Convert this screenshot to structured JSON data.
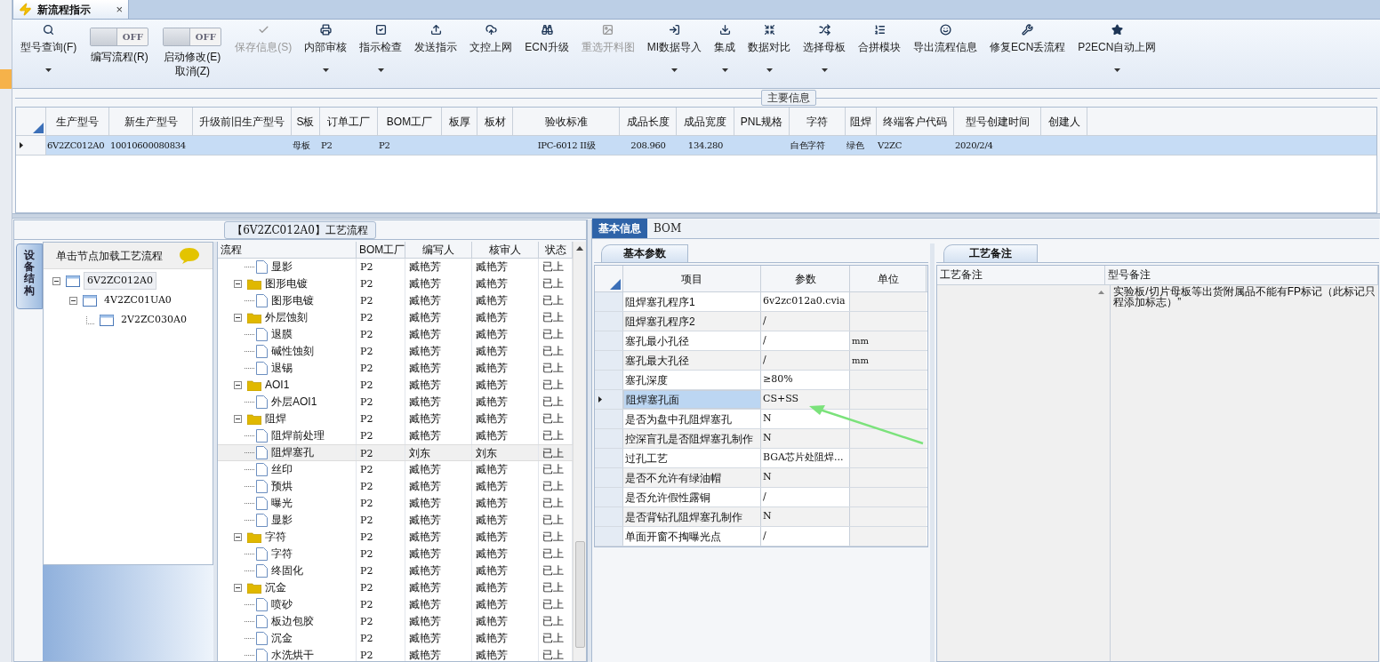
{
  "document_tab": {
    "title": "新流程指示",
    "close": "×"
  },
  "toolbar": [
    {
      "kind": "button",
      "label": "型号查询(F)",
      "dropdown": true,
      "disabled": false
    },
    {
      "kind": "toggle",
      "label": "编写流程(R)",
      "switch": "OFF",
      "on": false
    },
    {
      "kind": "toggle",
      "label": "启动修改(E)",
      "sublabel": "取消(Z)",
      "switch": "OFF",
      "on": false
    },
    {
      "kind": "button",
      "label": "保存信息(S)",
      "dropdown": false,
      "disabled": true
    },
    {
      "kind": "button",
      "label": "内部审核",
      "dropdown": true,
      "disabled": false
    },
    {
      "kind": "button",
      "label": "指示检查",
      "dropdown": true,
      "disabled": false
    },
    {
      "kind": "button",
      "label": "发送指示",
      "dropdown": false,
      "disabled": false
    },
    {
      "kind": "button",
      "label": "文控上网",
      "dropdown": false,
      "disabled": false
    },
    {
      "kind": "button",
      "label": "ECN升级",
      "dropdown": false,
      "disabled": false
    },
    {
      "kind": "button",
      "label": "重选开料图",
      "dropdown": false,
      "disabled": true
    },
    {
      "kind": "button",
      "label": "MI数据导入",
      "dropdown": true,
      "disabled": false
    },
    {
      "kind": "button",
      "label": "集成",
      "dropdown": true,
      "disabled": false
    },
    {
      "kind": "button",
      "label": "数据对比",
      "dropdown": true,
      "disabled": false
    },
    {
      "kind": "button",
      "label": "选择母板",
      "dropdown": true,
      "disabled": false
    },
    {
      "kind": "button",
      "label": "合拼模块",
      "dropdown": false,
      "disabled": false
    },
    {
      "kind": "button",
      "label": "导出流程信息",
      "dropdown": false,
      "disabled": false
    },
    {
      "kind": "button",
      "label": "修复ECN丢流程",
      "dropdown": false,
      "disabled": false
    },
    {
      "kind": "button",
      "label": "P2ECN自动上网",
      "dropdown": true,
      "disabled": false
    }
  ],
  "main_info": {
    "title": "主要信息",
    "columns": [
      "生产型号",
      "新生产型号",
      "升级前旧生产型号",
      "S板",
      "订单工厂",
      "BOM工厂",
      "板厚",
      "板材",
      "验收标准",
      "成品长度",
      "成品宽度",
      "PNL规格",
      "字符",
      "阻焊",
      "终端客户代码",
      "型号创建时间",
      "创建人"
    ],
    "rows": [
      {
        "selected": true,
        "cells": [
          "6V2ZC012A0",
          "10010600080834",
          null,
          "母板",
          "P2",
          "P2",
          null,
          null,
          "IPC-6012 II级",
          "208.960",
          "134.280",
          null,
          "白色字符",
          "绿色",
          "V2ZC",
          "2020/2/4",
          null
        ]
      }
    ]
  },
  "process_panel": {
    "title": "【6V2ZC012A0】工艺流程",
    "side_tab": "设备结构",
    "tree_hint": "单击节点加载工艺流程",
    "tree": [
      {
        "label": "6V2ZC012A0",
        "selected": true,
        "expanded": true,
        "children": [
          {
            "label": "4V2ZC01UA0",
            "selected": false,
            "expanded": true,
            "children": [
              {
                "label": "2V2ZC030A0",
                "selected": false
              }
            ]
          }
        ]
      }
    ],
    "columns": [
      "流程",
      "BOM工厂",
      "编写人",
      "核审人",
      "状态"
    ],
    "rows": [
      {
        "kind": "step",
        "name": "显影",
        "factory": "P2",
        "writer": "臧艳芳",
        "reviewer": "臧艳芳",
        "status": "已上",
        "selected": false
      },
      {
        "kind": "folder",
        "name": "图形电镀",
        "factory": "P2",
        "writer": "臧艳芳",
        "reviewer": "臧艳芳",
        "status": "已上",
        "selected": false,
        "expanded": true,
        "children": [
          {
            "kind": "step",
            "name": "图形电镀",
            "factory": "P2",
            "writer": "臧艳芳",
            "reviewer": "臧艳芳",
            "status": "已上",
            "selected": false
          }
        ]
      },
      {
        "kind": "folder",
        "name": "外层蚀刻",
        "factory": "P2",
        "writer": "臧艳芳",
        "reviewer": "臧艳芳",
        "status": "已上",
        "selected": false,
        "expanded": true,
        "children": [
          {
            "kind": "step",
            "name": "退膜",
            "factory": "P2",
            "writer": "臧艳芳",
            "reviewer": "臧艳芳",
            "status": "已上",
            "selected": false
          },
          {
            "kind": "step",
            "name": "碱性蚀刻",
            "factory": "P2",
            "writer": "臧艳芳",
            "reviewer": "臧艳芳",
            "status": "已上",
            "selected": false
          },
          {
            "kind": "step",
            "name": "退锡",
            "factory": "P2",
            "writer": "臧艳芳",
            "reviewer": "臧艳芳",
            "status": "已上",
            "selected": false
          }
        ]
      },
      {
        "kind": "folder",
        "name": "AOI1",
        "factory": "P2",
        "writer": "臧艳芳",
        "reviewer": "臧艳芳",
        "status": "已上",
        "selected": false,
        "expanded": true,
        "children": [
          {
            "kind": "step",
            "name": "外层AOI1",
            "factory": "P2",
            "writer": "臧艳芳",
            "reviewer": "臧艳芳",
            "status": "已上",
            "selected": false
          }
        ]
      },
      {
        "kind": "folder",
        "name": "阻焊",
        "factory": "P2",
        "writer": "臧艳芳",
        "reviewer": "臧艳芳",
        "status": "已上",
        "selected": false,
        "expanded": true,
        "children": [
          {
            "kind": "step",
            "name": "阻焊前处理",
            "factory": "P2",
            "writer": "臧艳芳",
            "reviewer": "臧艳芳",
            "status": "已上",
            "selected": false
          },
          {
            "kind": "step",
            "name": "阻焊塞孔",
            "factory": "P2",
            "writer": "刘东",
            "reviewer": "刘东",
            "status": "已上",
            "selected": true
          },
          {
            "kind": "step",
            "name": "丝印",
            "factory": "P2",
            "writer": "臧艳芳",
            "reviewer": "臧艳芳",
            "status": "已上",
            "selected": false
          },
          {
            "kind": "step",
            "name": "预烘",
            "factory": "P2",
            "writer": "臧艳芳",
            "reviewer": "臧艳芳",
            "status": "已上",
            "selected": false
          },
          {
            "kind": "step",
            "name": "曝光",
            "factory": "P2",
            "writer": "臧艳芳",
            "reviewer": "臧艳芳",
            "status": "已上",
            "selected": false
          },
          {
            "kind": "step",
            "name": "显影",
            "factory": "P2",
            "writer": "臧艳芳",
            "reviewer": "臧艳芳",
            "status": "已上",
            "selected": false
          }
        ]
      },
      {
        "kind": "folder",
        "name": "字符",
        "factory": "P2",
        "writer": "臧艳芳",
        "reviewer": "臧艳芳",
        "status": "已上",
        "selected": false,
        "expanded": true,
        "children": [
          {
            "kind": "step",
            "name": "字符",
            "factory": "P2",
            "writer": "臧艳芳",
            "reviewer": "臧艳芳",
            "status": "已上",
            "selected": false
          },
          {
            "kind": "step",
            "name": "终固化",
            "factory": "P2",
            "writer": "臧艳芳",
            "reviewer": "臧艳芳",
            "status": "已上",
            "selected": false
          }
        ]
      },
      {
        "kind": "folder",
        "name": "沉金",
        "factory": "P2",
        "writer": "臧艳芳",
        "reviewer": "臧艳芳",
        "status": "已上",
        "selected": false,
        "expanded": true,
        "children": [
          {
            "kind": "step",
            "name": "喷砂",
            "factory": "P2",
            "writer": "臧艳芳",
            "reviewer": "臧艳芳",
            "status": "已上",
            "selected": false
          },
          {
            "kind": "step",
            "name": "板边包胶",
            "factory": "P2",
            "writer": "臧艳芳",
            "reviewer": "臧艳芳",
            "status": "已上",
            "selected": false
          },
          {
            "kind": "step",
            "name": "沉金",
            "factory": "P2",
            "writer": "臧艳芳",
            "reviewer": "臧艳芳",
            "status": "已上",
            "selected": false
          },
          {
            "kind": "step",
            "name": "水洗烘干",
            "factory": "P2",
            "writer": "臧艳芳",
            "reviewer": "臧艳芳",
            "status": "已上",
            "selected": false
          }
        ]
      }
    ]
  },
  "detail_tabs": [
    {
      "label": "基本信息",
      "selected": true
    },
    {
      "label": "BOM",
      "selected": false
    }
  ],
  "params": {
    "tab": "基本参数",
    "columns": [
      "项目",
      "参数",
      "单位"
    ],
    "rows": [
      {
        "item": "阻焊塞孔程序1",
        "value": "6v2zc012a0.cvia",
        "selected": false
      },
      {
        "item": "阻焊塞孔程序2",
        "value": "/",
        "selected": false
      },
      {
        "item": "塞孔最小孔径",
        "value": "/",
        "unit": "mm",
        "selected": false
      },
      {
        "item": "塞孔最大孔径",
        "value": "/",
        "unit": "mm",
        "selected": false
      },
      {
        "item": "塞孔深度",
        "value": "≥80%",
        "selected": false
      },
      {
        "item": "阻焊塞孔面",
        "value": "CS+SS",
        "selected": true
      },
      {
        "item": "是否为盘中孔阻焊塞孔",
        "value": "N",
        "selected": false
      },
      {
        "item": "控深盲孔是否阻焊塞孔制作",
        "value": "N",
        "selected": false
      },
      {
        "item": "过孔工艺",
        "value": "BGA芯片处阻焊...",
        "selected": false
      },
      {
        "item": "是否不允许有绿油帽",
        "value": "N",
        "selected": false
      },
      {
        "item": "是否允许假性露铜",
        "value": "/",
        "selected": false
      },
      {
        "item": "是否背钻孔阻焊塞孔制作",
        "value": "N",
        "selected": false
      },
      {
        "item": "单面开窗不掏曝光点",
        "value": "/",
        "selected": false
      }
    ]
  },
  "notes": {
    "tab": "工艺备注",
    "columns": [
      "工艺备注",
      "型号备注"
    ],
    "model_note_lines": [
      "实验板/切片母板等出货附属品不能有FP标记（此标记只",
      "程添加标志）”"
    ]
  }
}
